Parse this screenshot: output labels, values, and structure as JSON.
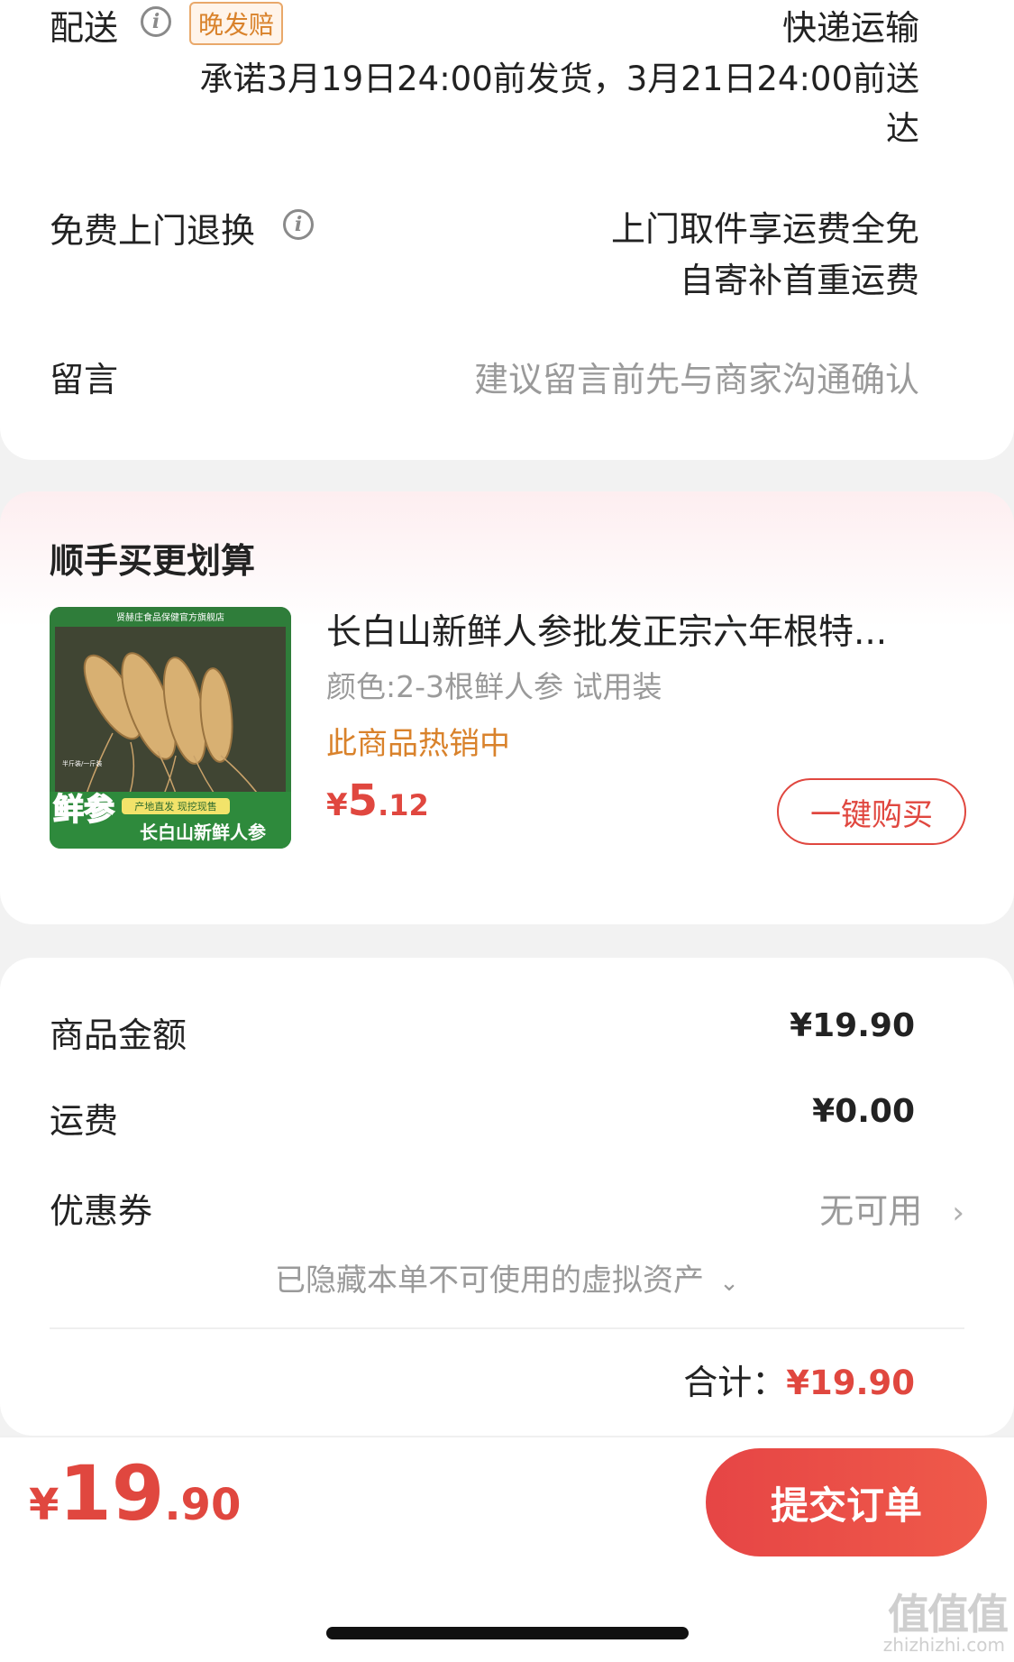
{
  "delivery": {
    "label": "配送",
    "badge": "晚发赔",
    "method": "快递运输",
    "promise_line1": "承诺3月19日24:00前发货，3月21日24:00前送",
    "promise_line2": "达"
  },
  "returns": {
    "label": "免费上门退换",
    "line1": "上门取件享运费全免",
    "line2": "自寄补首重运费"
  },
  "message": {
    "label": "留言",
    "placeholder": "建议留言前先与商家沟通确认"
  },
  "upsell": {
    "title": "顺手买更划算",
    "product": {
      "name": "长白山新鲜人参批发正宗六年根特...",
      "spec": "颜色:2-3根鲜人参 试用装",
      "hot": "此商品热销中",
      "currency": "¥",
      "price_int": "5",
      "price_dec": ".12",
      "buy_label": "一键购买",
      "image": {
        "store_banner": "贤赫庄食品保健官方旗舰店",
        "tag_fresh": "鲜参",
        "tag_weight": "半斤装/一斤装",
        "tag_origin": "产地直发 现挖现售",
        "tag_name": "长白山新鲜人参"
      }
    }
  },
  "summary": {
    "goods_label": "商品金额",
    "goods_value": "¥19.90",
    "shipping_label": "运费",
    "shipping_value": "¥0.00",
    "coupon_label": "优惠券",
    "coupon_value": "无可用",
    "hidden_assets": "已隐藏本单不可使用的虚拟资产",
    "total_label": "合计：",
    "total_value": "¥19.90"
  },
  "bottom_bar": {
    "currency": "¥",
    "price_int": "19",
    "price_dec": ".90",
    "submit_label": "提交订单"
  },
  "watermark": {
    "logo_text": "值值值",
    "site": "zhizhizhi.com"
  },
  "colors": {
    "accent": "#e0473f",
    "orange": "#d9822b",
    "muted": "#8a8a8a"
  }
}
